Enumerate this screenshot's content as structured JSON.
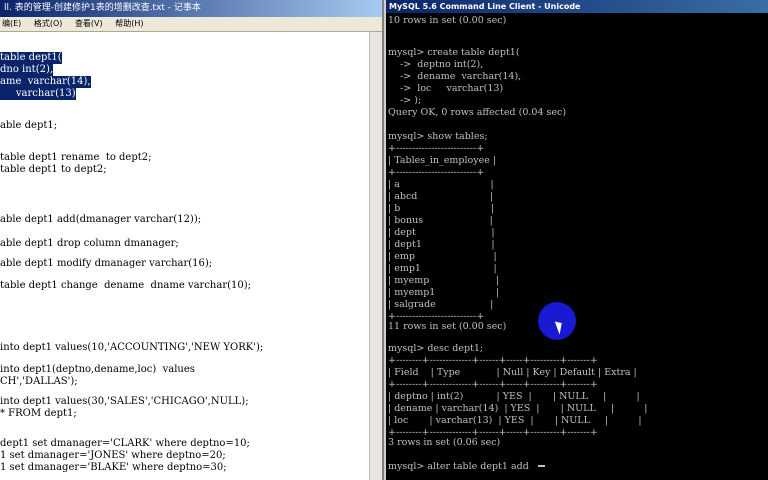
{
  "notepad": {
    "title": "ll. 表的管理-创建修护1表的增删改查.txt - 记事本",
    "menu": [
      "编(E)",
      "格式(O)",
      "查看(V)",
      "帮助(H)"
    ],
    "lines": [
      {
        "text": "table dept1(",
        "selected": true
      },
      {
        "text": "dno int(2),",
        "selected": true
      },
      {
        "text": "ame  varchar(14),",
        "selected": true
      },
      {
        "text": "     varchar(13)",
        "selected": true
      },
      {
        "text": "",
        "selected": false
      },
      {
        "text": "able dept1;",
        "selected": false
      },
      {
        "text": "",
        "selected": false
      },
      {
        "text": "table dept1 rename  to dept2;",
        "selected": false
      },
      {
        "text": "table dept1 to dept2;",
        "selected": false
      },
      {
        "text": "",
        "selected": false
      },
      {
        "text": "able dept1 add(dmanager varchar(12));",
        "selected": false
      },
      {
        "text": "able dept1 drop column dmanager;",
        "selected": false
      },
      {
        "text": "able dept1 modify dmanager varchar(16);",
        "selected": false
      },
      {
        "text": "table dept1 change  dename  dname varchar(10);",
        "selected": false
      },
      {
        "text": "into dept1 values(10,'ACCOUNTING','NEW YORK');",
        "selected": false
      },
      {
        "text": "into dept1(deptno,dename,loc)  values",
        "selected": false
      },
      {
        "text": "CH','DALLAS');",
        "selected": false
      },
      {
        "text": "into dept1 values(30,'SALES','CHICAGO',NULL);",
        "selected": false
      },
      {
        "text": "* FROM dept1;",
        "selected": false
      },
      {
        "text": "dept1 set dmanager='CLARK' where deptno=10;",
        "selected": false
      },
      {
        "text": "1 set dmanager='JONES' where deptno=20;",
        "selected": false
      },
      {
        "text": "1 set dmanager='BLAKE' where deptno=30;",
        "selected": false
      }
    ]
  },
  "console": {
    "title": "MySQL 5.6 Command Line Client - Unicode",
    "lines": [
      "10 rows in set (0.00 sec)",
      "",
      "mysql> create table dept1(",
      "    ->  deptno int(2),",
      "    ->  dename  varchar(14),",
      "    ->  loc     varchar(13)",
      "    -> );",
      "Query OK, 0 rows affected (0.04 sec)",
      "",
      "mysql> show tables;",
      "+-------------------------+",
      "| Tables_in_employee |",
      "+-------------------------+",
      "| a                              |",
      "| abcd                        |",
      "| b                              |",
      "| bonus                      |",
      "| dept                         |",
      "| dept1                       |",
      "| emp                          |",
      "| emp1                        |",
      "| myemp                      |",
      "| myemp1                    |",
      "| salgrade                  |",
      "+-------------------------+",
      "11 rows in set (0.00 sec)",
      "",
      "mysql> desc dept1;",
      "+--------+-------------+------+-----+---------+-------+",
      "| Field    | Type            | Null | Key | Default | Extra |",
      "+--------+-------------+------+-----+---------+-------+",
      "| deptno | int(2)           | YES  |       | NULL     |          |",
      "| dename | varchar(14)  | YES  |       | NULL     |          |",
      "| loc       | varchar(13)  | YES  |       | NULL     |          |",
      "+--------+-------------+------+-----+---------+-------+",
      "3 rows in set (0.06 sec)",
      "",
      "mysql> alter table dept1 add"
    ]
  }
}
